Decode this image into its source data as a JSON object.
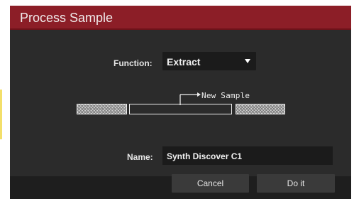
{
  "dialog": {
    "title": "Process Sample",
    "accent_color": "#8c1e27"
  },
  "function": {
    "label": "Function:",
    "value": "Extract"
  },
  "diagram": {
    "new_sample_label": "New Sample"
  },
  "name": {
    "label": "Name:",
    "value": "Synth Discover C1"
  },
  "buttons": {
    "cancel": "Cancel",
    "do_it": "Do it"
  }
}
